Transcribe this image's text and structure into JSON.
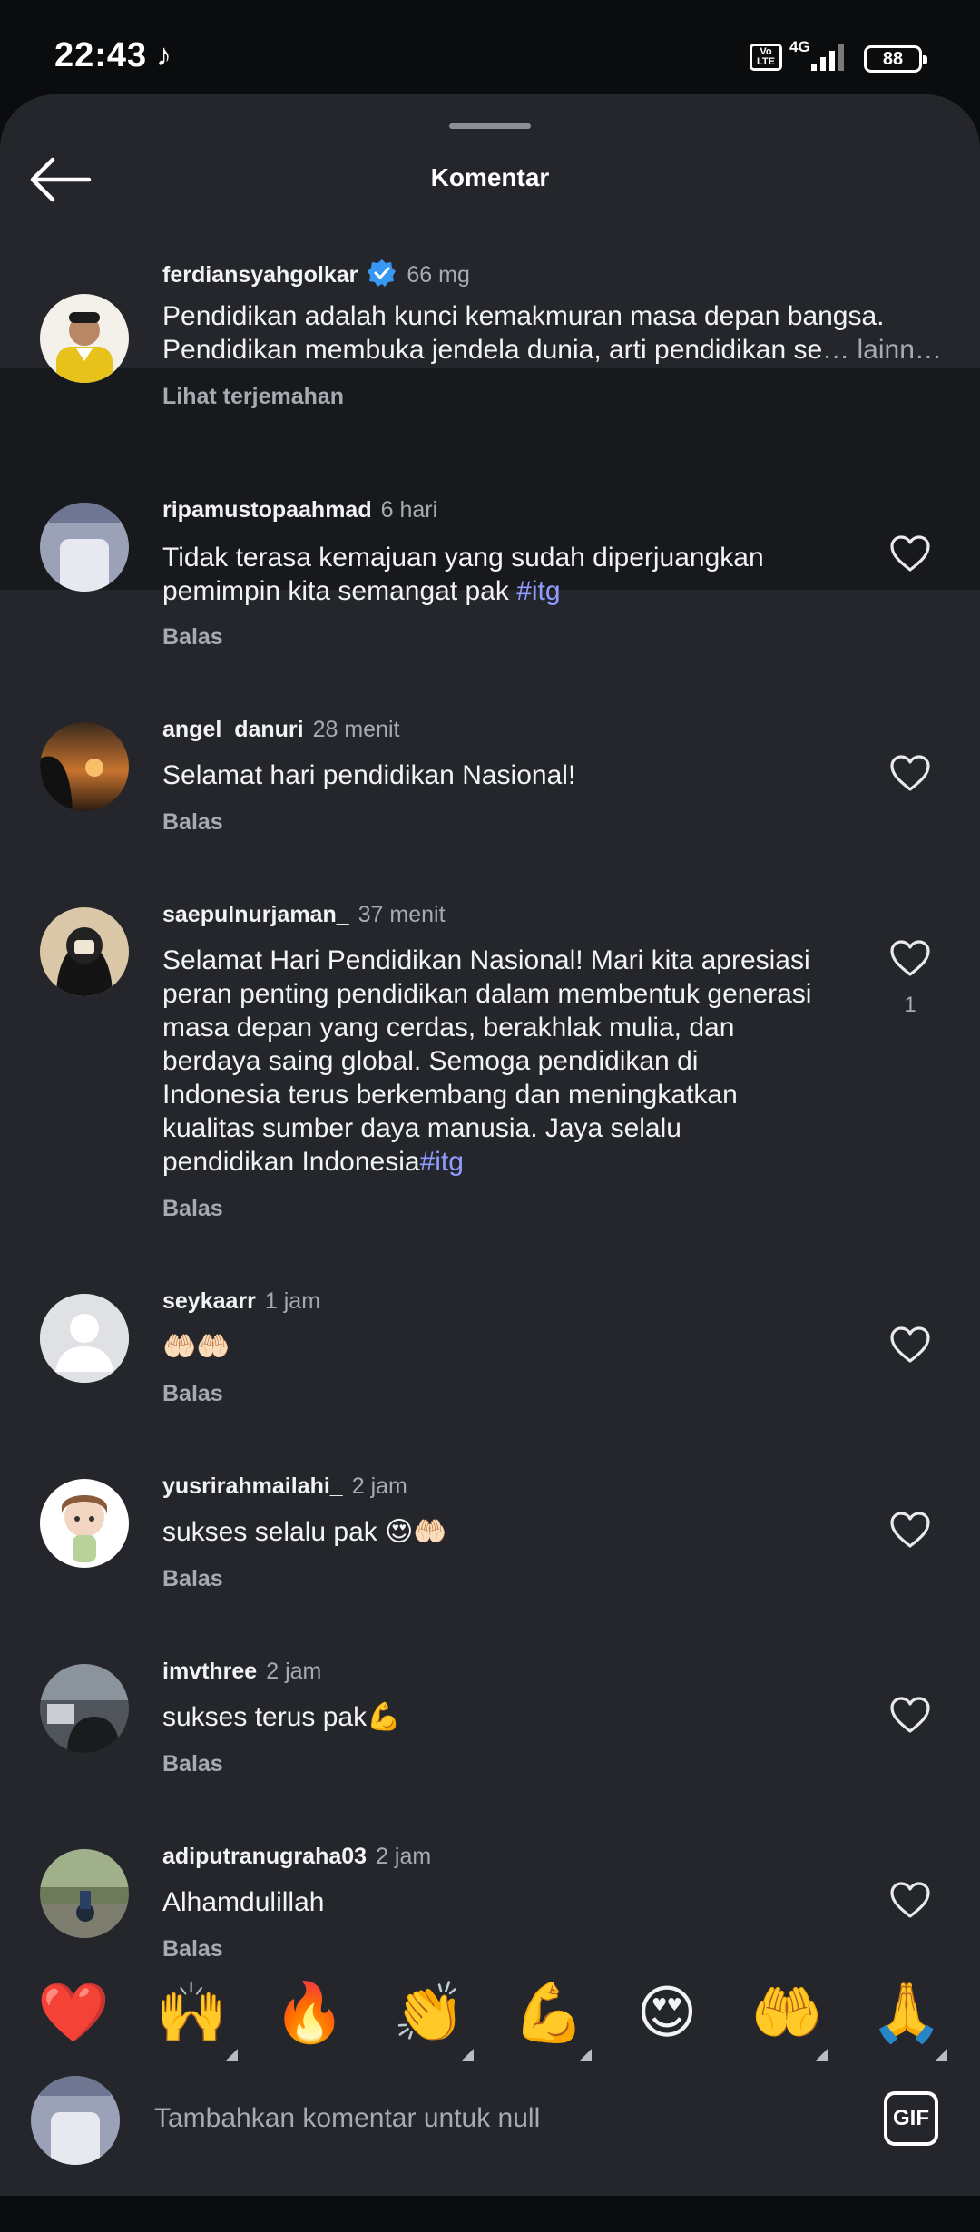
{
  "status": {
    "time": "22:43",
    "network": "4G",
    "volte": "Vo LTE",
    "battery": "88"
  },
  "header": {
    "title": "Komentar"
  },
  "caption": {
    "username": "ferdiansyahgolkar",
    "time": "66 mg",
    "text_l1": "Pendidikan adalah kunci kemakmuran masa depan bangsa.",
    "text_l2_a": "Pendidikan membuka jendela dunia, arti pendidikan se",
    "text_l2_more": "… lainn…",
    "translate": "Lihat terjemahan"
  },
  "comments": [
    {
      "username": "ripamustopaahmad",
      "time": "6 hari",
      "line1": "Tidak terasa kemajuan yang sudah diperjuangkan",
      "line2": "pemimpin kita semangat pak ",
      "hashtag": "#itg",
      "reply": "Balas"
    },
    {
      "username": "angel_danuri",
      "time": "28 menit",
      "text": "Selamat hari pendidikan Nasional!",
      "reply": "Balas"
    },
    {
      "username": "saepulnurjaman_",
      "time": "37 menit",
      "lines": [
        "Selamat Hari Pendidikan Nasional! Mari kita apresiasi",
        "peran penting pendidikan dalam membentuk generasi",
        "masa depan yang cerdas, berakhlak mulia, dan",
        "berdaya saing global. Semoga pendidikan di",
        "Indonesia terus berkembang dan meningkatkan",
        "kualitas sumber daya manusia. Jaya selalu"
      ],
      "last_line": "pendidikan Indonesia",
      "hashtag": "#itg",
      "likes": "1",
      "reply": "Balas"
    },
    {
      "username": "seykaarr",
      "time": "1 jam",
      "text": "🤲🏻🤲🏻",
      "reply": "Balas"
    },
    {
      "username": "yusrirahmailahi_",
      "time": "2 jam",
      "text": "sukses selalu pak 😍🤲🏻",
      "reply": "Balas"
    },
    {
      "username": "imvthree",
      "time": "2 jam",
      "text": "sukses terus pak💪",
      "reply": "Balas"
    },
    {
      "username": "adiputranugraha03",
      "time": "2 jam",
      "text": "Alhamdulillah",
      "reply": "Balas"
    }
  ],
  "quick_emojis": [
    "❤️",
    "🙌",
    "🔥",
    "👏",
    "💪",
    "😍",
    "🤲",
    "🙏"
  ],
  "composer": {
    "placeholder": "Tambahkan komentar untuk null",
    "gif_label": "GIF"
  },
  "colors": {
    "sheet": "#24262b",
    "highlight_row": "#18191c",
    "hashtag": "#8f9cff",
    "verified": "#3897f0"
  }
}
